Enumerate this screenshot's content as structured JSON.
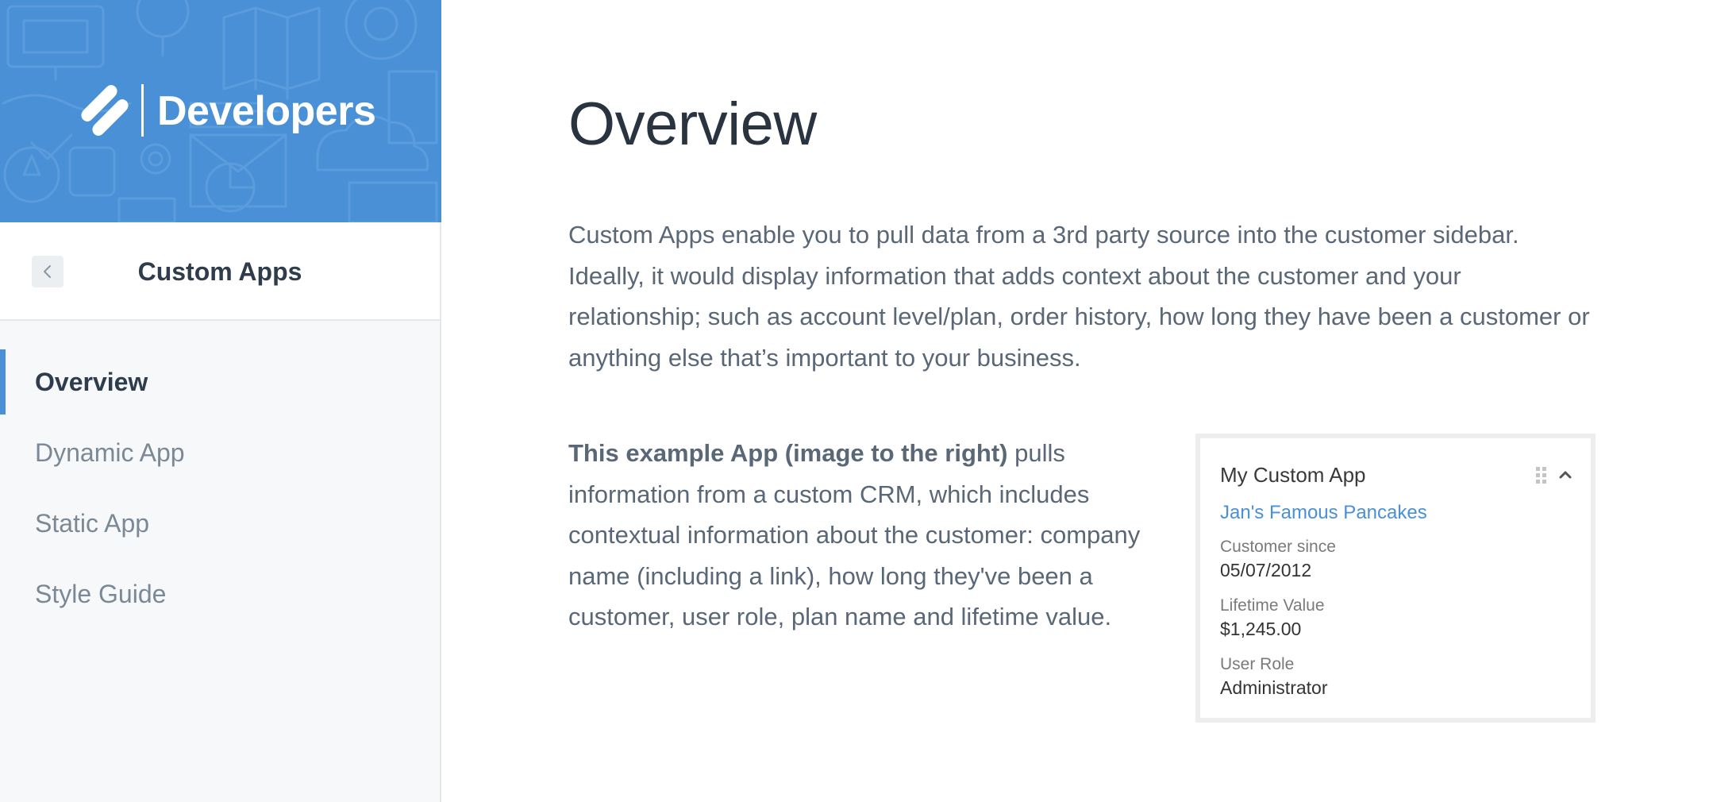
{
  "brand": {
    "title": "Developers",
    "logo_icon": "help-scout-logo-icon",
    "background_color": "#4a90d6"
  },
  "sidebar": {
    "section_title": "Custom Apps",
    "back_icon": "chevron-left-icon",
    "items": [
      {
        "label": "Overview",
        "active": true
      },
      {
        "label": "Dynamic App",
        "active": false
      },
      {
        "label": "Static App",
        "active": false
      },
      {
        "label": "Style Guide",
        "active": false
      }
    ]
  },
  "main": {
    "title": "Overview",
    "intro": "Custom Apps enable you to pull data from a 3rd party source into the customer sidebar. Ideally, it would display information that adds context about the customer and your relationship; such as account level/plan, order history, how long they have been a customer or anything else that’s important to your business.",
    "example_bold": "This example App (image to the right)",
    "example_rest": " pulls information from a custom CRM, which includes contextual information about the customer: company name (including a link), how long they've been a customer, user role, plan name and lifetime value."
  },
  "card": {
    "title": "My Custom App",
    "link": "Jan's Famous Pancakes",
    "fields": [
      {
        "label": "Customer since",
        "value": "05/07/2012"
      },
      {
        "label": "Lifetime Value",
        "value": "$1,245.00"
      },
      {
        "label": "User Role",
        "value": "Administrator"
      }
    ],
    "drag_icon": "drag-handle-icon",
    "collapse_icon": "chevron-up-icon",
    "link_color": "#4a90d6"
  }
}
